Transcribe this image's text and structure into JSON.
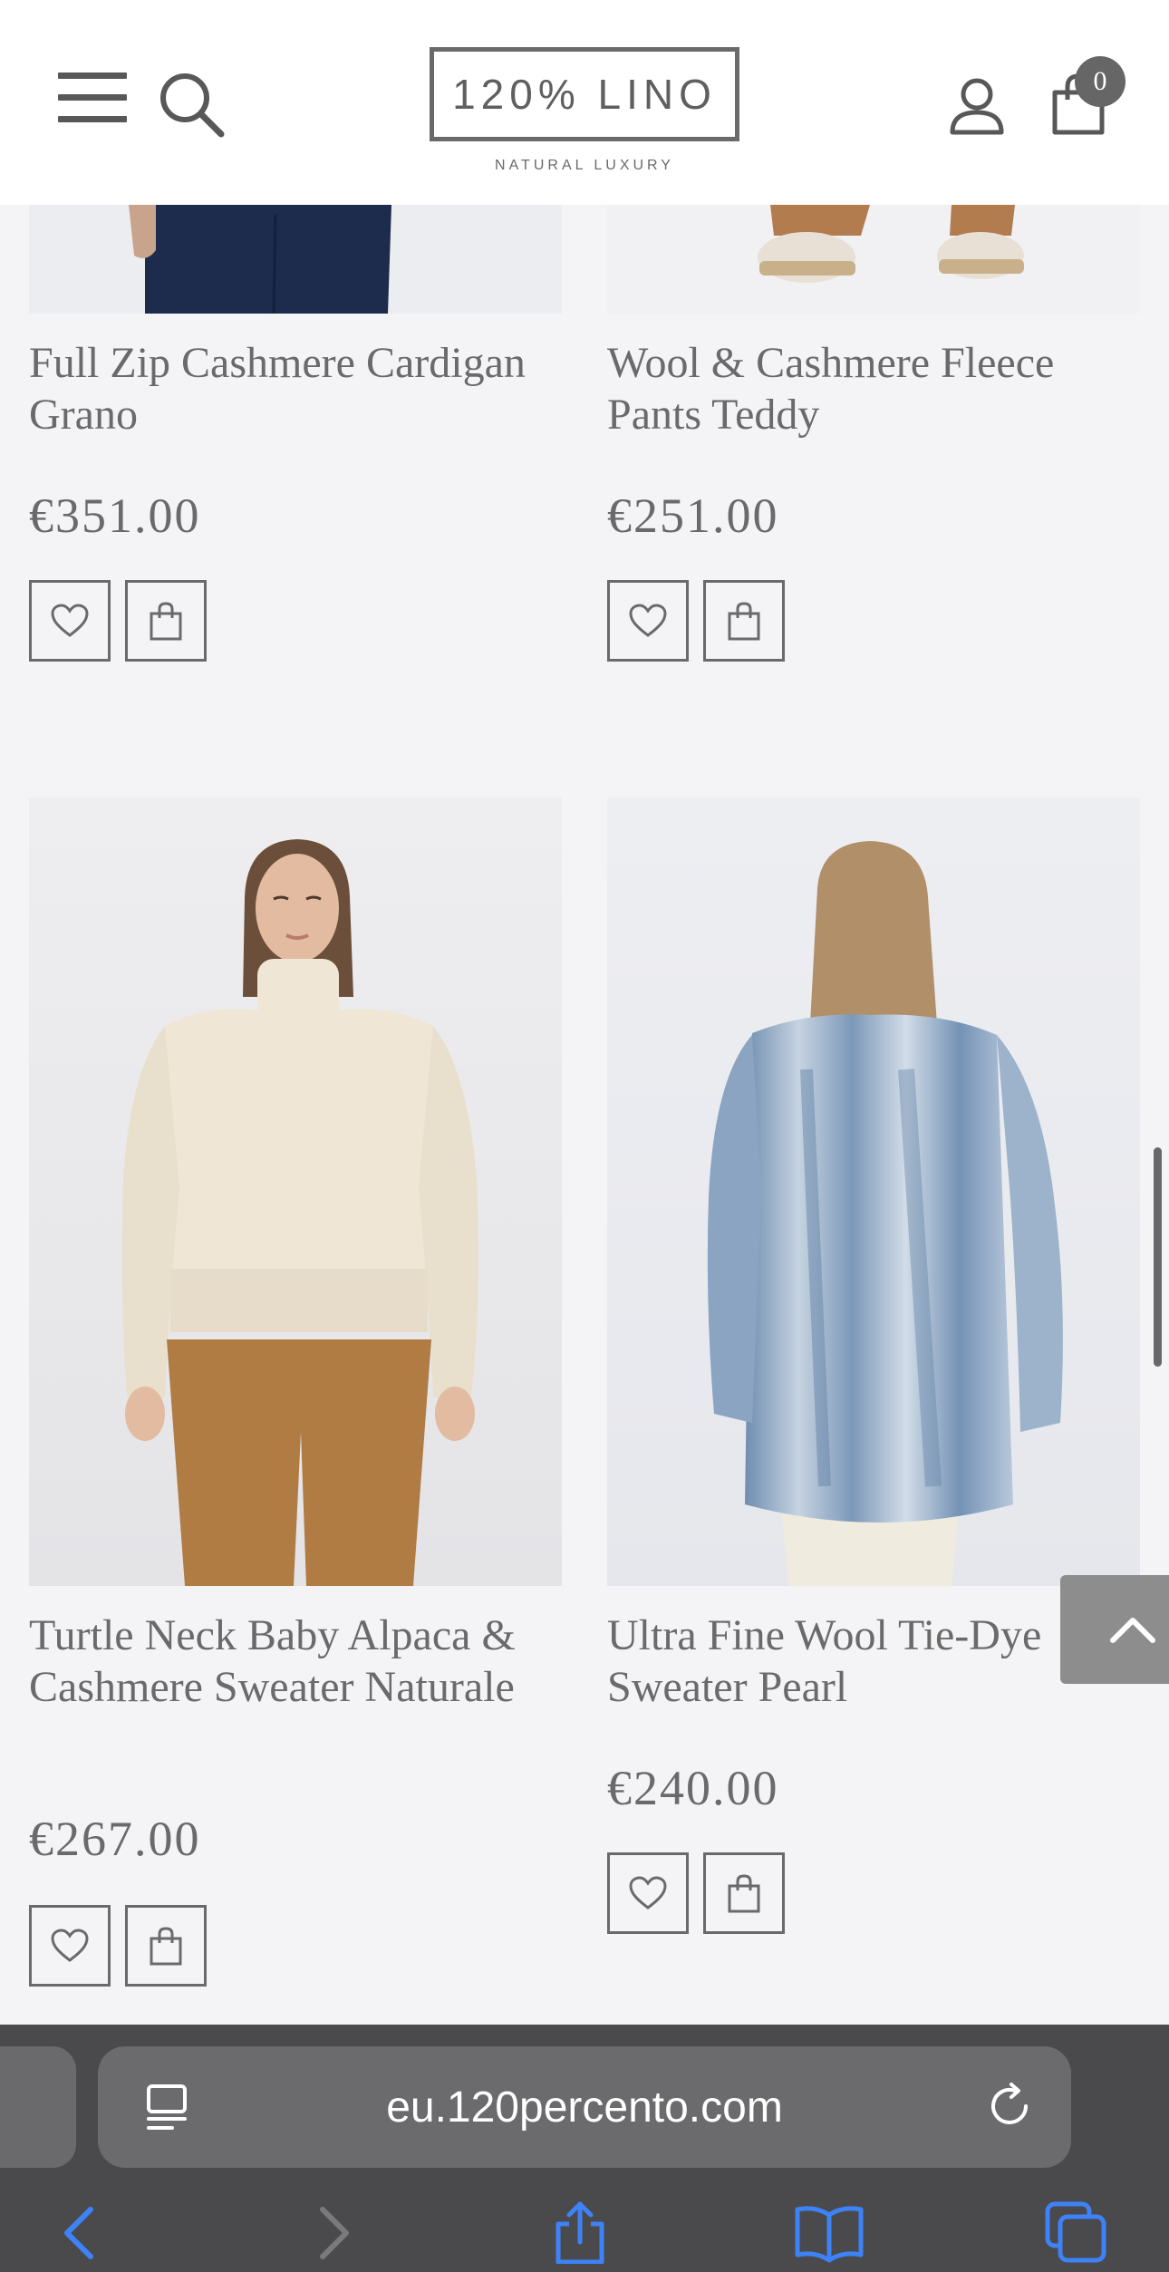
{
  "header": {
    "logo_text": "120% LINO",
    "logo_tagline": "NATURAL LUXURY",
    "cart_count": "0",
    "icons": [
      "menu-icon",
      "search-icon",
      "account-icon",
      "shopping-bag-icon"
    ]
  },
  "products": [
    {
      "name": "Full Zip Cashmere Cardigan Grano",
      "price": "€351.00"
    },
    {
      "name": "Wool & Cashmere Fleece Pants Teddy",
      "price": "€251.00"
    },
    {
      "name": "Turtle Neck Baby Alpaca & Cashmere Sweater Naturale",
      "price": "€267.00"
    },
    {
      "name": "Ultra Fine Wool Tie-Dye Sweater Pearl",
      "price": "€240.00"
    }
  ],
  "browser": {
    "url": "eu.120percento.com",
    "toolbar_icons": [
      "back-icon",
      "forward-icon",
      "share-icon",
      "bookmarks-icon",
      "tabs-icon"
    ]
  },
  "colors": {
    "page_background": "#f4f4f7",
    "text": "#6a6a6a",
    "browser_chrome": "#4a4a4c",
    "scroll_top_button": "#8d8d8d"
  }
}
